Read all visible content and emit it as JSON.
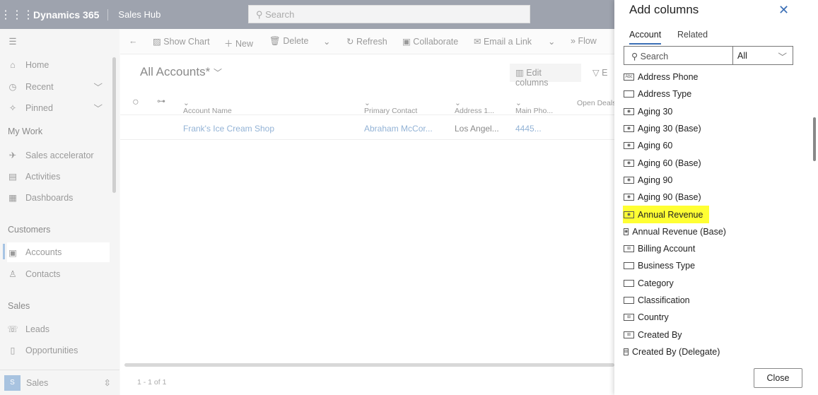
{
  "header": {
    "app": "Dynamics 365",
    "hub": "Sales Hub",
    "search_placeholder": "Search"
  },
  "sidebar": {
    "items": [
      {
        "label": "Home",
        "icon": "home-icon"
      },
      {
        "label": "Recent",
        "icon": "clock-icon"
      },
      {
        "label": "Pinned",
        "icon": "pin-icon"
      }
    ],
    "my_work": {
      "title": "My Work",
      "items": [
        "Sales accelerator",
        "Activities",
        "Dashboards"
      ]
    },
    "customers": {
      "title": "Customers",
      "items": [
        "Accounts",
        "Contacts"
      ]
    },
    "sales": {
      "title": "Sales",
      "items": [
        "Leads",
        "Opportunities"
      ]
    },
    "area": {
      "initial": "S",
      "label": "Sales"
    }
  },
  "commands": [
    "Show Chart",
    "New",
    "Delete",
    "Refresh",
    "Collaborate",
    "Email a Link",
    "Flow"
  ],
  "view": {
    "title": "All Accounts*",
    "edit_columns": "Edit columns",
    "filter": "E"
  },
  "grid": {
    "columns": [
      "Account Name",
      "Primary Contact",
      "Address 1...",
      "Main Pho...",
      "Open Deals"
    ],
    "rows": [
      [
        "Frank's Ice Cream Shop",
        "Abraham McCor...",
        "Los Angel...",
        "4445..."
      ]
    ],
    "count": "1 - 1 of 1"
  },
  "panel": {
    "title": "Add columns",
    "tabs": [
      "Account",
      "Related"
    ],
    "search_placeholder": "Search",
    "filter_value": "All",
    "highlight_color": "#ffff33",
    "columns": [
      {
        "label": "Address Phone",
        "icon": "text-field-icon"
      },
      {
        "label": "Address Type",
        "icon": "option-set-icon"
      },
      {
        "label": "Aging 30",
        "icon": "currency-icon"
      },
      {
        "label": "Aging 30 (Base)",
        "icon": "currency-icon"
      },
      {
        "label": "Aging 60",
        "icon": "currency-icon"
      },
      {
        "label": "Aging 60 (Base)",
        "icon": "currency-icon"
      },
      {
        "label": "Aging 90",
        "icon": "currency-icon"
      },
      {
        "label": "Aging 90 (Base)",
        "icon": "currency-icon"
      },
      {
        "label": "Annual Revenue",
        "icon": "currency-icon",
        "highlighted": true
      },
      {
        "label": "Annual Revenue (Base)",
        "icon": "currency-icon"
      },
      {
        "label": "Billing Account",
        "icon": "lookup-icon"
      },
      {
        "label": "Business Type",
        "icon": "option-set-icon"
      },
      {
        "label": "Category",
        "icon": "option-set-icon"
      },
      {
        "label": "Classification",
        "icon": "option-set-icon"
      },
      {
        "label": "Country",
        "icon": "lookup-icon"
      },
      {
        "label": "Created By",
        "icon": "lookup-icon"
      },
      {
        "label": "Created By (Delegate)",
        "icon": "lookup-icon"
      }
    ],
    "close_label": "Close"
  }
}
